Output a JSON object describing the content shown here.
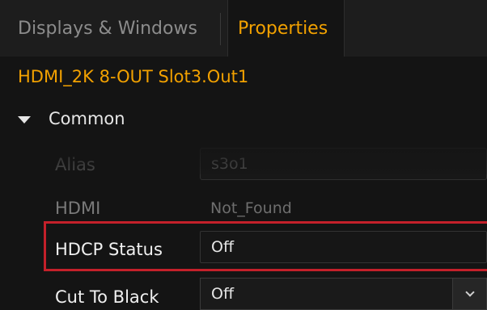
{
  "tabs": {
    "displays_label": "Displays & Windows",
    "properties_label": "Properties"
  },
  "device": {
    "title": "HDMI_2K 8-OUT  Slot3.Out1"
  },
  "section": {
    "label": "Common",
    "expanded": true
  },
  "properties": {
    "alias": {
      "label": "Alias",
      "value": "s3o1"
    },
    "hdmi": {
      "label": "HDMI",
      "value": "Not_Found"
    },
    "hdcp": {
      "label": "HDCP Status",
      "value": "Off"
    },
    "cut_to_black": {
      "label": "Cut To Black",
      "value": "Off"
    }
  },
  "colors": {
    "accent": "#f2a100",
    "highlight": "#c4202a",
    "background": "#141414"
  }
}
